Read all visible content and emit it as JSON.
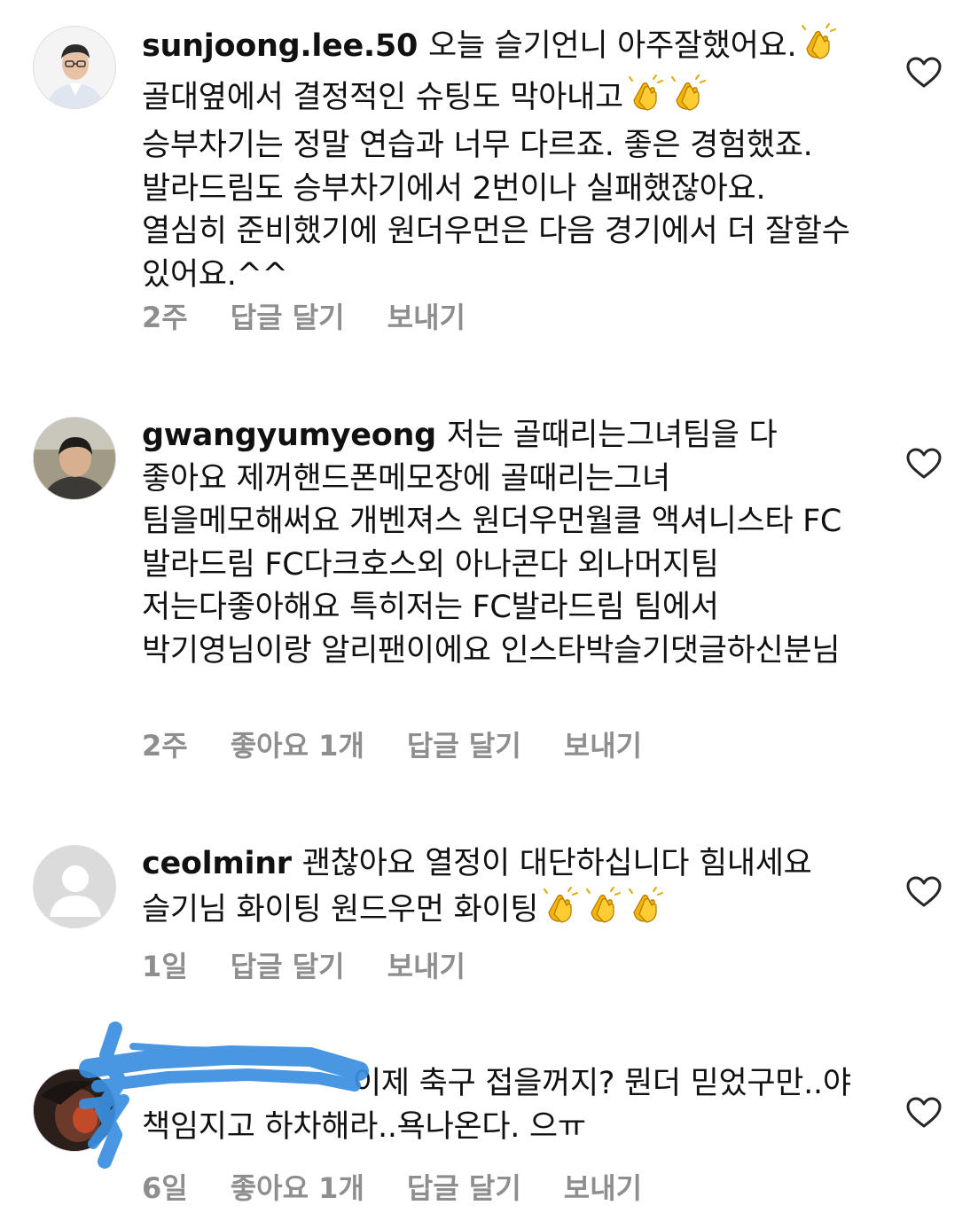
{
  "comments": [
    {
      "username": "sunjoong.lee.50",
      "segments": [
        "오늘 슬기언니 아주잘했어요.",
        " 골대옆에서 결정적인 슈팅도 막아내고",
        " 승부차기는 정말 연습과 너무 다르죠. 좋은 경험했죠. 발라드림도 승부차기에서 2번이나 실패했잖아요. 열심히 준비했기에 원더우먼은 다음 경기에서 더 잘할수 있어요.^^"
      ],
      "time": "2주",
      "likes": "",
      "reply_label": "답글 달기",
      "send_label": "보내기",
      "avatar": "man-portrait"
    },
    {
      "username": "gwangyumyeong",
      "segments": [
        "저는 골때리는그녀팀을 다 좋아요 제꺼핸드폰메모장에 골때리는그녀 팀을메모해써요 개벤져스 원더우먼월클 액셔니스타 FC 발라드림 FC다크호스외 아나콘다 외나머지팀 저는다좋아해요 특히저는 FC발라드림 팀에서 박기영님이랑 알리팬이에요 인스타박슬기댓글하신분님"
      ],
      "time": "2주",
      "likes": "좋아요 1개",
      "reply_label": "답글 달기",
      "send_label": "보내기",
      "avatar": "person-photo"
    },
    {
      "username": "ceolminr",
      "segments": [
        "괜찮아요 열정이 대단하십니다 힘내세요 슬기님 화이팅 원드우먼 화이팅"
      ],
      "time": "1일",
      "likes": "",
      "reply_label": "답글 달기",
      "send_label": "보내기",
      "avatar": "default-silhouette"
    },
    {
      "username": "",
      "segments": [
        "이제 축구 접을꺼지? 뭔더 믿었구만..야 책임지고 하차해라..욕나온다. 으ㅠ"
      ],
      "time": "6일",
      "likes": "좋아요 1개",
      "reply_label": "답글 달기",
      "send_label": "보내기",
      "avatar": "dark-photo"
    }
  ],
  "icons": {
    "like": "heart-outline-icon",
    "clap": "clapping-hands-emoji"
  },
  "colors": {
    "text": "#111111",
    "meta": "#8e8e8e",
    "heart": "#262626",
    "redaction": "#3a8fe0",
    "emoji": "#f4b400"
  }
}
